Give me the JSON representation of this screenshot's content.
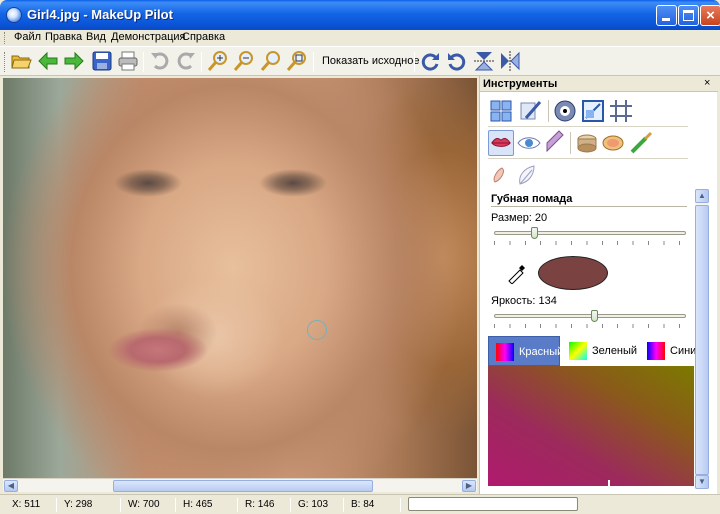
{
  "window": {
    "title": "Girl4.jpg - MakeUp Pilot"
  },
  "menu": {
    "items": [
      "Файл",
      "Правка",
      "Вид",
      "Демонстрация",
      "Справка"
    ]
  },
  "toolbar": {
    "show_original_label": "Показать исходное",
    "icons": [
      "open-folder-icon",
      "back-arrow-icon",
      "forward-arrow-icon",
      "save-icon",
      "print-icon",
      "undo-icon",
      "redo-icon",
      "zoom-in-icon",
      "zoom-out-icon",
      "zoom-fit-icon",
      "zoom-actual-icon",
      "rotate-cw-icon",
      "rotate-ccw-icon",
      "flip-vertical-icon",
      "flip-horizontal-icon"
    ]
  },
  "panel": {
    "title": "Инструменты",
    "close_glyph": "×",
    "section_title": "Губная помада",
    "size_label": "Размер: 20",
    "size_value": 20,
    "brightness_label": "Яркость: 134",
    "brightness_value": 134,
    "lipstick_color": "#7a4240",
    "tabs": [
      {
        "label": "Красный",
        "active": true
      },
      {
        "label": "Зеленый",
        "active": false
      },
      {
        "label": "Синий",
        "active": false
      }
    ]
  },
  "status": {
    "x": "X: 511",
    "y": "Y: 298",
    "w": "W: 700",
    "h": "H: 465",
    "r": "R: 146",
    "g": "G: 103",
    "b": "B: 84"
  },
  "colors": {
    "title_blue": "#0b55d8",
    "panel_tab_active": "#5a7cc8"
  }
}
